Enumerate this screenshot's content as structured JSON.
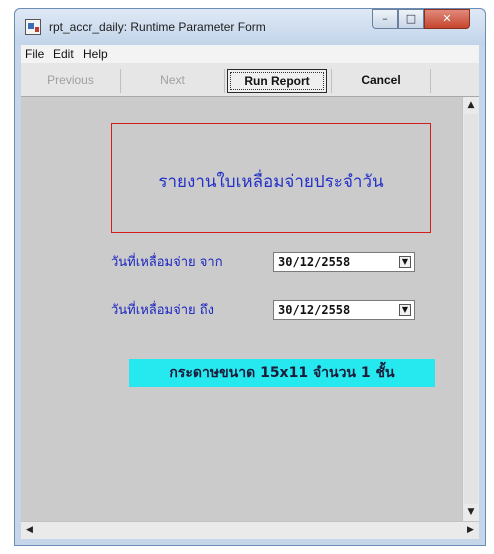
{
  "window": {
    "title": "rpt_accr_daily: Runtime Parameter Form",
    "controls": {
      "minimize": "–",
      "maximize": "□",
      "close": "✕"
    }
  },
  "menu": [
    "File",
    "Edit",
    "Help"
  ],
  "toolbar": {
    "previous": "Previous",
    "next": "Next",
    "run_report": "Run Report",
    "cancel": "Cancel"
  },
  "form": {
    "report_title": "รายงานใบเหลื่อมจ่ายประจำวัน",
    "from_label": "วันที่เหลื่อมจ่าย  จาก",
    "from_value": "30/12/2558",
    "to_label": "วันที่เหลื่อมจ่าย  ถึง",
    "to_value": "30/12/2558",
    "paper_note": "กระดาษขนาด 15x11 จำนวน 1 ชั้น"
  },
  "scroll": {
    "up": "▲",
    "down": "▼",
    "left": "◀",
    "right": "▶"
  },
  "icons": {
    "app": "report-app-icon",
    "dropdown": "chevron-down-icon"
  },
  "colors": {
    "title_text": "#2330c8",
    "title_border": "#d21e1e",
    "note_background": "#26e9ef",
    "form_background": "#cbcbcb"
  }
}
